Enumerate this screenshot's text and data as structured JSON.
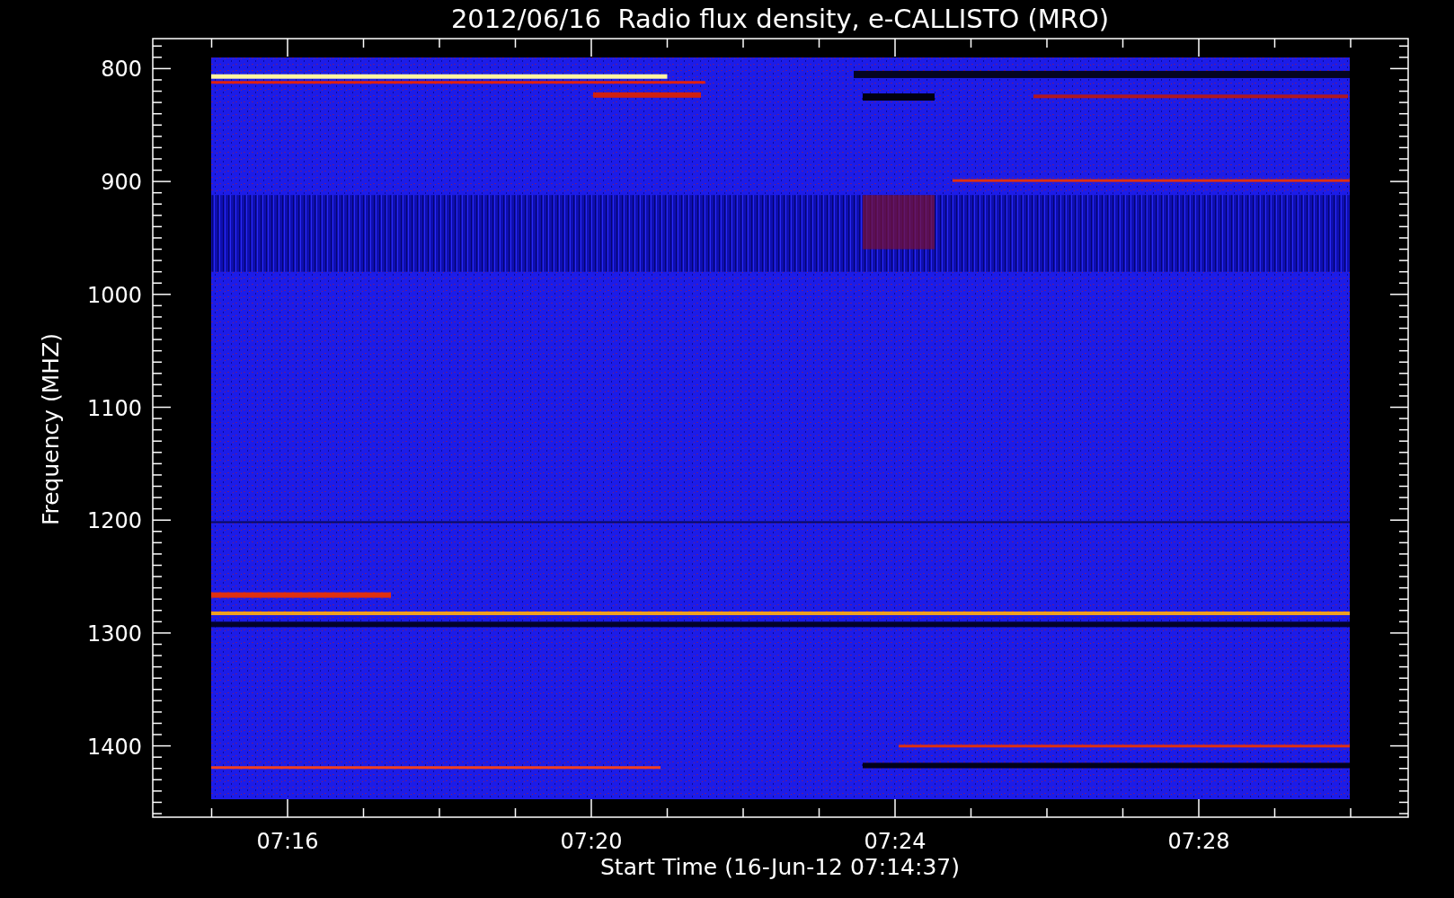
{
  "title": "2012/06/16  Radio flux density, e-CALLISTO (MRO)",
  "y_axis": {
    "label": "Frequency (MHZ)",
    "ticks": [
      "800",
      "900",
      "1000",
      "1100",
      "1200",
      "1300",
      "1400"
    ]
  },
  "x_axis": {
    "label": "Start Time (16-Jun-12 07:14:37)",
    "ticks": [
      "07:16",
      "07:20",
      "07:24",
      "07:28"
    ]
  }
}
